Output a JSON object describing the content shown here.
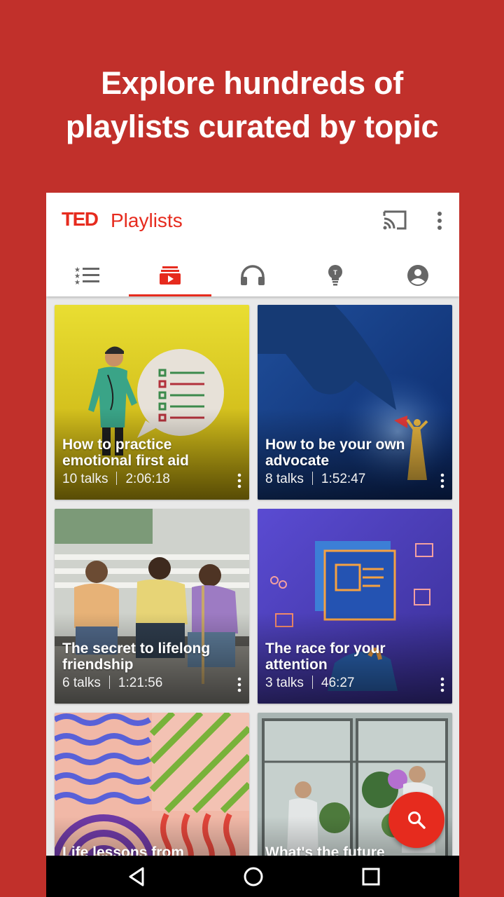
{
  "headline": {
    "line1": "Explore hundreds of",
    "line2": "playlists curated by topic"
  },
  "appbar": {
    "logo": "TED",
    "title": "Playlists",
    "cast_icon": "cast-icon",
    "more_icon": "more-vert-icon"
  },
  "tabs": [
    {
      "name": "lists",
      "icon": "list-icon",
      "active": false
    },
    {
      "name": "playlists",
      "icon": "playlist-icon",
      "active": true
    },
    {
      "name": "podcasts",
      "icon": "headphones-icon",
      "active": false
    },
    {
      "name": "ideas",
      "icon": "lightbulb-icon",
      "active": false
    },
    {
      "name": "account",
      "icon": "account-icon",
      "active": false
    }
  ],
  "playlists": [
    {
      "title": "How to practice emotional first aid",
      "talks": "10 talks",
      "duration": "2:06:18"
    },
    {
      "title": "How to be your own advocate",
      "talks": "8 talks",
      "duration": "1:52:47"
    },
    {
      "title": "The secret to lifelong friendship",
      "talks": "6 talks",
      "duration": "1:21:56"
    },
    {
      "title": "The race for your attention",
      "talks": "3 talks",
      "duration": "46:27"
    },
    {
      "title": "Life lessons from",
      "talks": "",
      "duration": ""
    },
    {
      "title": "What's the future",
      "talks": "",
      "duration": ""
    }
  ],
  "fab": {
    "icon": "search-icon"
  },
  "navbar": {
    "back_icon": "back-icon",
    "home_icon": "home-icon",
    "recents_icon": "recents-icon"
  },
  "colors": {
    "brand_red": "#e62b1e",
    "background_red": "#c1302b"
  }
}
